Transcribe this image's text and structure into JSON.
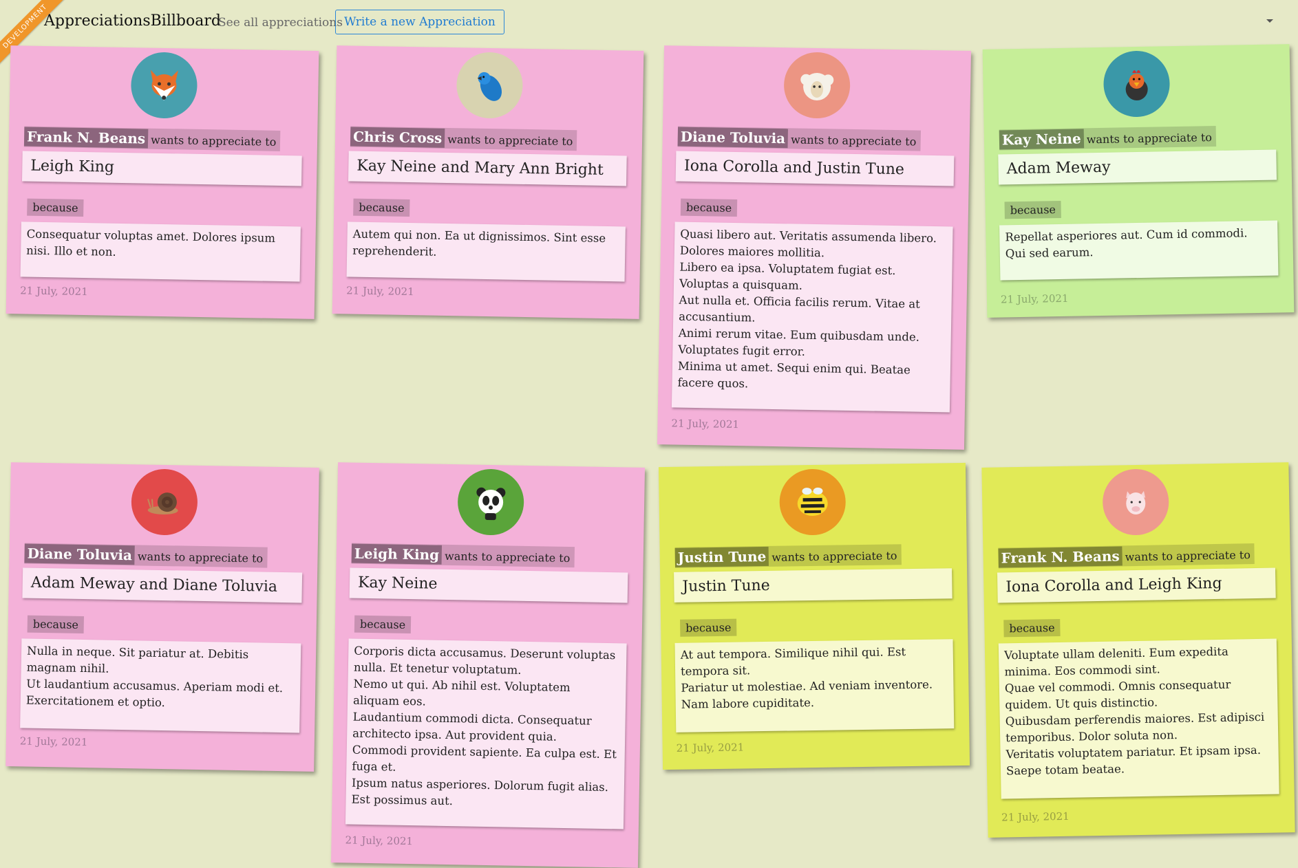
{
  "header": {
    "ribbon": "DEVELOPMENT",
    "brand": "AppreciationsBillboard",
    "see_all": "See all appreciations",
    "write_new": "Write a new Appreciation"
  },
  "labels": {
    "wants": "wants to appreciate to",
    "because": "because"
  },
  "cards": [
    {
      "color": "#f4b1d9",
      "icon": "fox-icon",
      "from": "Frank N. Beans",
      "to": "Leigh King",
      "message": [
        "Consequatur voluptas amet. Dolores ipsum nisi. Illo et non."
      ],
      "date": "21 July, 2021"
    },
    {
      "color": "#f4b1d9",
      "icon": "bird-icon",
      "from": "Chris Cross",
      "to": "Kay Neine and Mary Ann Bright",
      "message": [
        "Autem qui non. Ea ut dignissimos. Sint esse reprehenderit."
      ],
      "date": "21 July, 2021"
    },
    {
      "color": "#f4b1d9",
      "icon": "sheep-icon",
      "from": "Diane Toluvia",
      "to": "Iona Corolla and Justin Tune",
      "message": [
        "Quasi libero aut. Veritatis assumenda libero. Dolores maiores mollitia.",
        "Libero ea ipsa. Voluptatem fugiat est. Voluptas a quisquam.",
        "Aut nulla et. Officia facilis rerum. Vitae at accusantium.",
        "Animi rerum vitae. Eum quibusdam unde. Voluptates fugit error.",
        "Minima ut amet. Sequi enim qui. Beatae facere quos."
      ],
      "date": "21 July, 2021"
    },
    {
      "color": "#c6ee98",
      "icon": "rooster-icon",
      "from": "Kay Neine",
      "to": "Adam Meway",
      "message": [
        "Repellat asperiores aut. Cum id commodi. Qui sed earum."
      ],
      "date": "21 July, 2021"
    },
    {
      "color": "#f4b1d9",
      "icon": "snail-icon",
      "from": "Diane Toluvia",
      "to": "Adam Meway and Diane Toluvia",
      "message": [
        "Nulla in neque. Sit pariatur at. Debitis magnam nihil.",
        "Ut laudantium accusamus. Aperiam modi et. Exercitationem et optio."
      ],
      "date": "21 July, 2021"
    },
    {
      "color": "#f4b1d9",
      "icon": "panda-icon",
      "from": "Leigh King",
      "to": "Kay Neine",
      "message": [
        "Corporis dicta accusamus. Deserunt voluptas nulla. Et tenetur voluptatum.",
        "Nemo ut qui. Ab nihil est. Voluptatem aliquam eos.",
        "Laudantium commodi dicta. Consequatur architecto ipsa. Aut provident quia.",
        "Commodi provident sapiente. Ea culpa est. Et fuga et.",
        "Ipsum natus asperiores. Dolorum fugit alias. Est possimus aut."
      ],
      "date": "21 July, 2021"
    },
    {
      "color": "#e1ea57",
      "icon": "bee-icon",
      "from": "Justin Tune",
      "to": "Justin Tune",
      "message": [
        "At aut tempora. Similique nihil qui. Est tempora sit.",
        "Pariatur ut molestiae. Ad veniam inventore. Nam labore cupiditate."
      ],
      "date": "21 July, 2021"
    },
    {
      "color": "#e1ea57",
      "icon": "pig-icon",
      "from": "Frank N. Beans",
      "to": "Iona Corolla and Leigh King",
      "message": [
        "Voluptate ullam deleniti. Eum expedita minima. Eos commodi sint.",
        "Quae vel commodi. Omnis consequatur quidem. Ut quis distinctio.",
        "Quibusdam perferendis maiores. Est adipisci temporibus. Dolor soluta non.",
        "Veritatis voluptatem pariatur. Et ipsam ipsa. Saepe totam beatae."
      ],
      "date": "21 July, 2021"
    }
  ]
}
